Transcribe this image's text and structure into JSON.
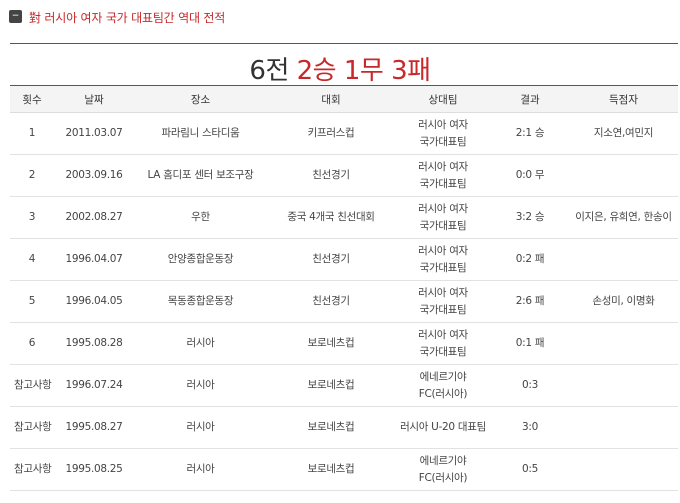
{
  "header": {
    "toggle_icon": "minus-box-icon",
    "title": "對 러시아 여자 국가 대표팀간 역대 전적"
  },
  "record": {
    "games": "6전",
    "wins": "2승",
    "draws": "1무",
    "losses": "3패"
  },
  "table": {
    "columns": [
      "횟수",
      "날짜",
      "장소",
      "대회",
      "상대팀",
      "결과",
      "득점자"
    ],
    "rows": [
      {
        "no": "1",
        "date": "2011.03.07",
        "venue": "파라림니 스타디움",
        "comp": "키프러스컵",
        "opp": "러시아 여자 국가대표팀",
        "result": "2:1 승",
        "scorers": "지소연,여민지"
      },
      {
        "no": "2",
        "date": "2003.09.16",
        "venue": "LA 홈디포 센터 보조구장",
        "comp": "친선경기",
        "opp": "러시아 여자 국가대표팀",
        "result": "0:0 무",
        "scorers": ""
      },
      {
        "no": "3",
        "date": "2002.08.27",
        "venue": "우한",
        "comp": "중국 4개국 친선대회",
        "opp": "러시아 여자 국가대표팀",
        "result": "3:2 승",
        "scorers": "이지은, 유희연, 한송이"
      },
      {
        "no": "4",
        "date": "1996.04.07",
        "venue": "안양종합운동장",
        "comp": "친선경기",
        "opp": "러시아 여자 국가대표팀",
        "result": "0:2 패",
        "scorers": ""
      },
      {
        "no": "5",
        "date": "1996.04.05",
        "venue": "목동종합운동장",
        "comp": "친선경기",
        "opp": "러시아 여자 국가대표팀",
        "result": "2:6 패",
        "scorers": "손성미, 이명화"
      },
      {
        "no": "6",
        "date": "1995.08.28",
        "venue": "러시아",
        "comp": "보로네츠컵",
        "opp": "러시아 여자 국가대표팀",
        "result": "0:1 패",
        "scorers": ""
      },
      {
        "no": "참고사항",
        "date": "1996.07.24",
        "venue": "러시아",
        "comp": "보로네츠컵",
        "opp": "에네르기야 FC(러시아)",
        "result": "0:3",
        "scorers": ""
      },
      {
        "no": "참고사항",
        "date": "1995.08.27",
        "venue": "러시아",
        "comp": "보로네츠컵",
        "opp": "러시아 U-20 대표팀",
        "result": "3:0",
        "scorers": ""
      },
      {
        "no": "참고사항",
        "date": "1995.08.25",
        "venue": "러시아",
        "comp": "보로네츠컵",
        "opp": "에네르기야 FC(러시아)",
        "result": "0:5",
        "scorers": ""
      }
    ]
  },
  "colors": {
    "accent": "#c8282a",
    "text": "#333333",
    "header_bg": "#f4f4f4"
  }
}
